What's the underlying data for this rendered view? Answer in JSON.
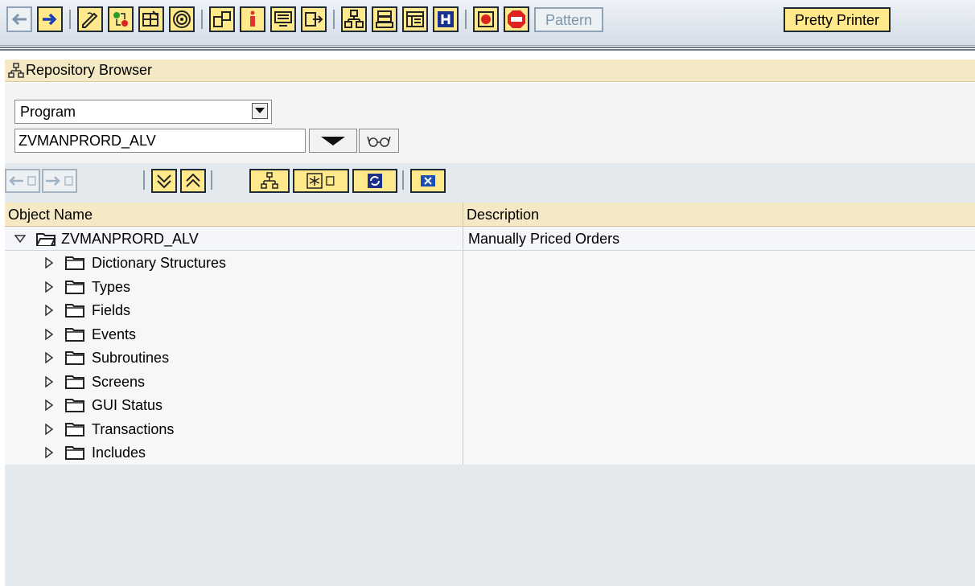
{
  "toolbar": {
    "pattern_label": "Pattern",
    "pretty_printer_label": "Pretty Printer"
  },
  "panel": {
    "title": "Repository Browser"
  },
  "selector": {
    "object_type": "Program",
    "object_name": "ZVMANPRORD_ALV"
  },
  "table": {
    "columns": [
      "Object Name",
      "Description"
    ],
    "root": {
      "name": "ZVMANPRORD_ALV",
      "description": "Manually Priced Orders"
    },
    "children": [
      "Dictionary Structures",
      "Types",
      "Fields",
      "Events",
      "Subroutines",
      "Screens",
      "GUI Status",
      "Transactions",
      "Includes"
    ]
  },
  "colors": {
    "toolbar_button": "#ffe98a",
    "header_tan": "#f5e8c4",
    "panel_gray": "#e4e9ee"
  }
}
